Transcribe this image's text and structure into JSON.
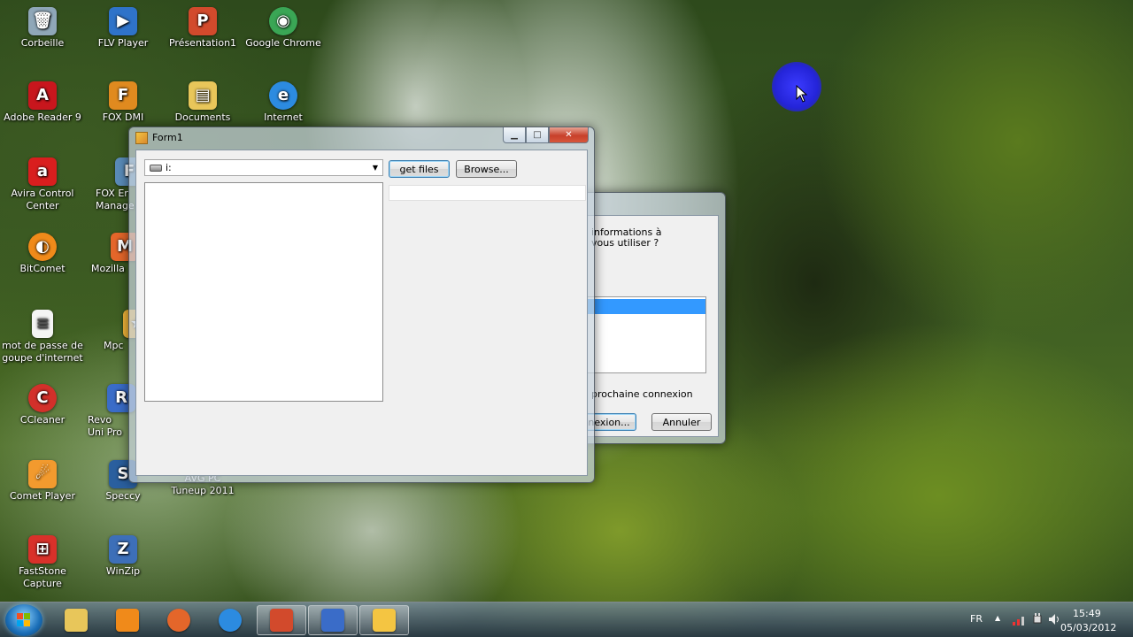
{
  "desktop": {
    "icons": [
      {
        "label": "Corbeille",
        "glyph": "recycle-bin-icon",
        "color": "#8fa7b8",
        "char": "🗑"
      },
      {
        "label": "FLV Player",
        "glyph": "flv-player-icon",
        "color": "#2f73c9",
        "char": "▶"
      },
      {
        "label": "Présentation1",
        "glyph": "powerpoint-file-icon",
        "color": "#d24a2c",
        "char": "P"
      },
      {
        "label": "Google Chrome",
        "glyph": "chrome-icon",
        "color": "#3aa655",
        "char": "◉"
      },
      {
        "label": "Adobe Reader 9",
        "glyph": "adobe-reader-icon",
        "color": "#c8161d",
        "char": "A"
      },
      {
        "label": "FOX DMI",
        "glyph": "fox-dmi-icon",
        "color": "#e08a1f",
        "char": "F"
      },
      {
        "label": "Documents",
        "glyph": "folder-icon",
        "color": "#e8c65a",
        "char": "▤"
      },
      {
        "label": "Internet",
        "glyph": "internet-icon",
        "color": "#2c8be0",
        "char": "e"
      },
      {
        "label": "Avira Control Center",
        "glyph": "avira-icon",
        "color": "#d91e1e",
        "char": "a"
      },
      {
        "label": "FOX Er Manage",
        "glyph": "fox-manager-icon",
        "color": "#5a8bb8",
        "char": "F"
      },
      {
        "label": "BitComet",
        "glyph": "bitcomet-icon",
        "color": "#f08a1a",
        "char": "◐"
      },
      {
        "label": "Mozilla",
        "glyph": "mozilla-icon",
        "color": "#e4662a",
        "char": "M"
      },
      {
        "label": "mot de passe de goupe d'internet",
        "glyph": "text-file-icon",
        "color": "#f4f4f4",
        "char": "≡"
      },
      {
        "label": "Mpc",
        "glyph": "mpc-icon",
        "color": "#f0b43a",
        "char": "★"
      },
      {
        "label": "CCleaner",
        "glyph": "ccleaner-icon",
        "color": "#d3302a",
        "char": "C"
      },
      {
        "label": "Revo Uni Pro",
        "glyph": "revo-uninstaller-icon",
        "color": "#3a6cc8",
        "char": "R"
      },
      {
        "label": "Comet Player",
        "glyph": "comet-player-icon",
        "color": "#f29a2e",
        "char": "☄"
      },
      {
        "label": "Speccy",
        "glyph": "speccy-icon",
        "color": "#2a5f9e",
        "char": "S"
      },
      {
        "label": "AVG PC Tuneup 2011",
        "glyph": "avg-tuneup-icon",
        "color": "#4a7a2a",
        "char": ""
      },
      {
        "label": "FastStone Capture",
        "glyph": "faststone-capture-icon",
        "color": "#d8312a",
        "char": "⊞"
      },
      {
        "label": "WinZip",
        "glyph": "winzip-icon",
        "color": "#3d6fb8",
        "char": "Z"
      }
    ]
  },
  "form1": {
    "title": "Form1",
    "minimize": "▁",
    "maximize": "□",
    "close": "✕",
    "drive_combo_value": "i:",
    "combo_arrow": "▼",
    "get_files_label": "get files",
    "browse_label": "Browse..."
  },
  "background_dialog": {
    "prompt_line1": "informations à",
    "prompt_line2": "vous utiliser ?",
    "checkbox_label": "prochaine connexion",
    "connect_label": "nexion...",
    "cancel_label": "Annuler"
  },
  "taskbar": {
    "items": [
      {
        "name": "taskbar-explorer",
        "icon": "explorer-icon",
        "color": "#e8c65a"
      },
      {
        "name": "taskbar-media-player",
        "icon": "media-player-icon",
        "color": "#f08a1a"
      },
      {
        "name": "taskbar-firefox",
        "icon": "firefox-icon",
        "color": "#e4662a"
      },
      {
        "name": "taskbar-internet-explorer",
        "icon": "internet-explorer-icon",
        "color": "#2c8be0"
      },
      {
        "name": "taskbar-powerpoint",
        "icon": "powerpoint-icon",
        "color": "#d24a2c"
      },
      {
        "name": "taskbar-network",
        "icon": "network-icon",
        "color": "#3a6cc8"
      },
      {
        "name": "taskbar-form-app",
        "icon": "form-app-icon",
        "color": "#f4c542"
      }
    ],
    "language": "FR",
    "show_hidden": "▲",
    "time": "15:49",
    "date": "05/03/2012"
  }
}
